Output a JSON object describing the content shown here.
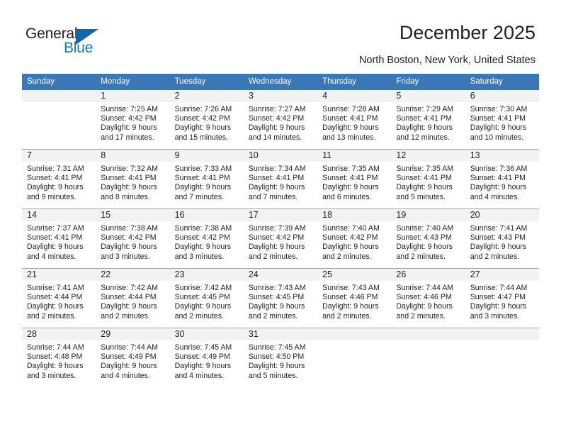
{
  "brand": {
    "name_part1": "General",
    "name_part2": "Blue",
    "accent_color": "#1878be",
    "triangle_color": "#1266ab",
    "triangle_icon": "triangle-icon"
  },
  "header": {
    "title": "December 2025",
    "location": "North Boston, New York, United States"
  },
  "calendar": {
    "header_bg": "#3a77b4",
    "daynum_bg": "#f2f2f2",
    "weekdays": [
      "Sunday",
      "Monday",
      "Tuesday",
      "Wednesday",
      "Thursday",
      "Friday",
      "Saturday"
    ],
    "weeks": [
      [
        {
          "day": "",
          "sunrise": "",
          "sunset": "",
          "daylight1": "",
          "daylight2": ""
        },
        {
          "day": "1",
          "sunrise": "Sunrise: 7:25 AM",
          "sunset": "Sunset: 4:42 PM",
          "daylight1": "Daylight: 9 hours",
          "daylight2": "and 17 minutes."
        },
        {
          "day": "2",
          "sunrise": "Sunrise: 7:26 AM",
          "sunset": "Sunset: 4:42 PM",
          "daylight1": "Daylight: 9 hours",
          "daylight2": "and 15 minutes."
        },
        {
          "day": "3",
          "sunrise": "Sunrise: 7:27 AM",
          "sunset": "Sunset: 4:42 PM",
          "daylight1": "Daylight: 9 hours",
          "daylight2": "and 14 minutes."
        },
        {
          "day": "4",
          "sunrise": "Sunrise: 7:28 AM",
          "sunset": "Sunset: 4:41 PM",
          "daylight1": "Daylight: 9 hours",
          "daylight2": "and 13 minutes."
        },
        {
          "day": "5",
          "sunrise": "Sunrise: 7:29 AM",
          "sunset": "Sunset: 4:41 PM",
          "daylight1": "Daylight: 9 hours",
          "daylight2": "and 12 minutes."
        },
        {
          "day": "6",
          "sunrise": "Sunrise: 7:30 AM",
          "sunset": "Sunset: 4:41 PM",
          "daylight1": "Daylight: 9 hours",
          "daylight2": "and 10 minutes."
        }
      ],
      [
        {
          "day": "7",
          "sunrise": "Sunrise: 7:31 AM",
          "sunset": "Sunset: 4:41 PM",
          "daylight1": "Daylight: 9 hours",
          "daylight2": "and 9 minutes."
        },
        {
          "day": "8",
          "sunrise": "Sunrise: 7:32 AM",
          "sunset": "Sunset: 4:41 PM",
          "daylight1": "Daylight: 9 hours",
          "daylight2": "and 8 minutes."
        },
        {
          "day": "9",
          "sunrise": "Sunrise: 7:33 AM",
          "sunset": "Sunset: 4:41 PM",
          "daylight1": "Daylight: 9 hours",
          "daylight2": "and 7 minutes."
        },
        {
          "day": "10",
          "sunrise": "Sunrise: 7:34 AM",
          "sunset": "Sunset: 4:41 PM",
          "daylight1": "Daylight: 9 hours",
          "daylight2": "and 7 minutes."
        },
        {
          "day": "11",
          "sunrise": "Sunrise: 7:35 AM",
          "sunset": "Sunset: 4:41 PM",
          "daylight1": "Daylight: 9 hours",
          "daylight2": "and 6 minutes."
        },
        {
          "day": "12",
          "sunrise": "Sunrise: 7:35 AM",
          "sunset": "Sunset: 4:41 PM",
          "daylight1": "Daylight: 9 hours",
          "daylight2": "and 5 minutes."
        },
        {
          "day": "13",
          "sunrise": "Sunrise: 7:36 AM",
          "sunset": "Sunset: 4:41 PM",
          "daylight1": "Daylight: 9 hours",
          "daylight2": "and 4 minutes."
        }
      ],
      [
        {
          "day": "14",
          "sunrise": "Sunrise: 7:37 AM",
          "sunset": "Sunset: 4:41 PM",
          "daylight1": "Daylight: 9 hours",
          "daylight2": "and 4 minutes."
        },
        {
          "day": "15",
          "sunrise": "Sunrise: 7:38 AM",
          "sunset": "Sunset: 4:42 PM",
          "daylight1": "Daylight: 9 hours",
          "daylight2": "and 3 minutes."
        },
        {
          "day": "16",
          "sunrise": "Sunrise: 7:38 AM",
          "sunset": "Sunset: 4:42 PM",
          "daylight1": "Daylight: 9 hours",
          "daylight2": "and 3 minutes."
        },
        {
          "day": "17",
          "sunrise": "Sunrise: 7:39 AM",
          "sunset": "Sunset: 4:42 PM",
          "daylight1": "Daylight: 9 hours",
          "daylight2": "and 2 minutes."
        },
        {
          "day": "18",
          "sunrise": "Sunrise: 7:40 AM",
          "sunset": "Sunset: 4:42 PM",
          "daylight1": "Daylight: 9 hours",
          "daylight2": "and 2 minutes."
        },
        {
          "day": "19",
          "sunrise": "Sunrise: 7:40 AM",
          "sunset": "Sunset: 4:43 PM",
          "daylight1": "Daylight: 9 hours",
          "daylight2": "and 2 minutes."
        },
        {
          "day": "20",
          "sunrise": "Sunrise: 7:41 AM",
          "sunset": "Sunset: 4:43 PM",
          "daylight1": "Daylight: 9 hours",
          "daylight2": "and 2 minutes."
        }
      ],
      [
        {
          "day": "21",
          "sunrise": "Sunrise: 7:41 AM",
          "sunset": "Sunset: 4:44 PM",
          "daylight1": "Daylight: 9 hours",
          "daylight2": "and 2 minutes."
        },
        {
          "day": "22",
          "sunrise": "Sunrise: 7:42 AM",
          "sunset": "Sunset: 4:44 PM",
          "daylight1": "Daylight: 9 hours",
          "daylight2": "and 2 minutes."
        },
        {
          "day": "23",
          "sunrise": "Sunrise: 7:42 AM",
          "sunset": "Sunset: 4:45 PM",
          "daylight1": "Daylight: 9 hours",
          "daylight2": "and 2 minutes."
        },
        {
          "day": "24",
          "sunrise": "Sunrise: 7:43 AM",
          "sunset": "Sunset: 4:45 PM",
          "daylight1": "Daylight: 9 hours",
          "daylight2": "and 2 minutes."
        },
        {
          "day": "25",
          "sunrise": "Sunrise: 7:43 AM",
          "sunset": "Sunset: 4:46 PM",
          "daylight1": "Daylight: 9 hours",
          "daylight2": "and 2 minutes."
        },
        {
          "day": "26",
          "sunrise": "Sunrise: 7:44 AM",
          "sunset": "Sunset: 4:46 PM",
          "daylight1": "Daylight: 9 hours",
          "daylight2": "and 2 minutes."
        },
        {
          "day": "27",
          "sunrise": "Sunrise: 7:44 AM",
          "sunset": "Sunset: 4:47 PM",
          "daylight1": "Daylight: 9 hours",
          "daylight2": "and 3 minutes."
        }
      ],
      [
        {
          "day": "28",
          "sunrise": "Sunrise: 7:44 AM",
          "sunset": "Sunset: 4:48 PM",
          "daylight1": "Daylight: 9 hours",
          "daylight2": "and 3 minutes."
        },
        {
          "day": "29",
          "sunrise": "Sunrise: 7:44 AM",
          "sunset": "Sunset: 4:49 PM",
          "daylight1": "Daylight: 9 hours",
          "daylight2": "and 4 minutes."
        },
        {
          "day": "30",
          "sunrise": "Sunrise: 7:45 AM",
          "sunset": "Sunset: 4:49 PM",
          "daylight1": "Daylight: 9 hours",
          "daylight2": "and 4 minutes."
        },
        {
          "day": "31",
          "sunrise": "Sunrise: 7:45 AM",
          "sunset": "Sunset: 4:50 PM",
          "daylight1": "Daylight: 9 hours",
          "daylight2": "and 5 minutes."
        },
        {
          "day": "",
          "sunrise": "",
          "sunset": "",
          "daylight1": "",
          "daylight2": ""
        },
        {
          "day": "",
          "sunrise": "",
          "sunset": "",
          "daylight1": "",
          "daylight2": ""
        },
        {
          "day": "",
          "sunrise": "",
          "sunset": "",
          "daylight1": "",
          "daylight2": ""
        }
      ]
    ]
  }
}
